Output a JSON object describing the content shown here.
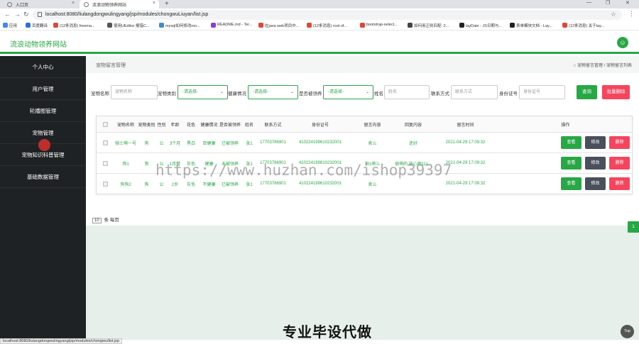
{
  "browser": {
    "tabs": [
      {
        "title": "入口页"
      },
      {
        "title": "流浪动物领养网站"
      }
    ],
    "url": "localhost:8080/liulangdongwulingyang/jsp/modules/chongwuLiuyan/list.jsp",
    "bookmarks": [
      "应用",
      "百度翻译",
      "(12条消息) freema...",
      "使用UEditor 报错C...",
      "mysql如何修改roo...",
      "README.md - Ter...",
      "在java web项目中...",
      "(12条消息) root of...",
      "bootstrap-select...",
      "如何用正则匹配: 2...",
      "layDate - JS日期与...",
      "表单模块文档 - Lay...",
      "(12条消息) 关于lay..."
    ],
    "status_url": "localhost:8080/liulangdongwulingyang/jsp/modules/chongwu/list.jsp"
  },
  "app": {
    "name": "流浪动物领养网站",
    "accent": "#28a745"
  },
  "sidebar": {
    "items": [
      {
        "label": "个人中心"
      },
      {
        "label": "用户管理"
      },
      {
        "label": "轮播图管理"
      },
      {
        "label": "宠物管理"
      },
      {
        "label": "宠物知识科普管理"
      },
      {
        "label": "基础数据管理"
      }
    ]
  },
  "breadcrumb": {
    "title": "宠物留言管理",
    "path": "宠物留言管理 / 宠物留言列表"
  },
  "search": {
    "pet_name_label": "宠物名称",
    "pet_name_placeholder": "宠物名称",
    "pet_type_label": "宠物类别",
    "pet_type_value": "-请选择-",
    "health_label": "健康情况",
    "health_value": "-请选择-",
    "adopted_label": "是否被领养",
    "adopted_value": "-请选择-",
    "name_label": "姓名",
    "name_placeholder": "姓名",
    "contact_label": "联系方式",
    "contact_placeholder": "联系方式",
    "id_label": "身份证号",
    "id_placeholder": "身份证号",
    "search_btn": "查询",
    "batch_delete_btn": "批量删除"
  },
  "table": {
    "columns": [
      "宠物名称",
      "宠物类别",
      "性别",
      "年龄",
      "花色",
      "健康情况",
      "是否被领养",
      "姓名",
      "联系方式",
      "身份证号",
      "留言内容",
      "回复内容",
      "留言时间",
      "操作"
    ],
    "rows": [
      [
        "骑士萌一号",
        "狗",
        "公",
        "3个月",
        "黑白",
        "亚健康",
        "已被领养",
        "张1",
        "17703786901",
        "410224199610232001",
        "卖么",
        "还好",
        "2021-04-29 17:09:32"
      ],
      [
        "狗1",
        "狗",
        "公",
        "1月整",
        "灰色",
        "健康",
        "未被领养",
        "张1",
        "17703786901",
        "410224199610232001",
        "狗1萌么",
        "很萌的,放心吧111...",
        "2021-04-29 17:09:32"
      ],
      [
        "狗狗2",
        "狗",
        "公",
        "2岁",
        "灰色",
        "不健康",
        "已被领养",
        "张1",
        "17703786901",
        "410224199610232001",
        "卖么",
        "",
        "2021-04-29 17:09:32"
      ]
    ],
    "actions": {
      "view": "查看",
      "edit": "修改",
      "delete": "删除"
    }
  },
  "pager": {
    "page_size": "10",
    "suffix": "条 每页",
    "current_page": "1"
  },
  "overlay": {
    "watermark": "https://www.huzhan.com/ishop39397",
    "caption": "专业毕设代做",
    "top_button": "Top"
  }
}
